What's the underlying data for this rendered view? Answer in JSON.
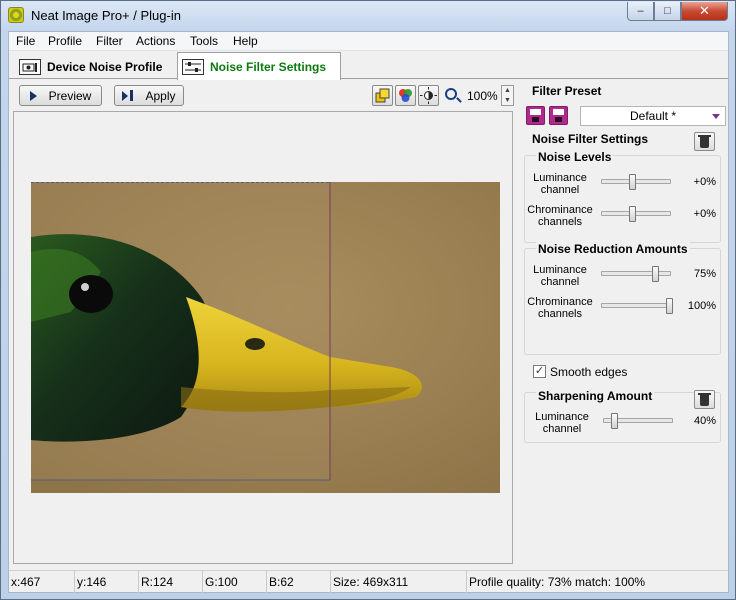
{
  "window": {
    "title": "Neat Image Pro+ / Plug-in"
  },
  "menu": [
    "File",
    "Profile",
    "Filter",
    "Actions",
    "Tools",
    "Help"
  ],
  "tabs": [
    {
      "label": "Device Noise Profile",
      "active": false
    },
    {
      "label": "Noise Filter Settings",
      "active": true
    }
  ],
  "toolbar": {
    "preview_label": "Preview",
    "apply_label": "Apply",
    "zoom": "100%"
  },
  "filter_preset": {
    "title": "Filter Preset",
    "value": "Default *"
  },
  "noise_filter_settings": {
    "title": "Noise Filter Settings",
    "noise_levels": {
      "title": "Noise Levels",
      "luminance": {
        "label": "Luminance channel",
        "value": "+0%",
        "level": 0.46
      },
      "chrominance": {
        "label": "Chrominance channels",
        "value": "+0%",
        "level": 0.46
      }
    },
    "noise_reduction": {
      "title": "Noise Reduction Amounts",
      "luminance": {
        "label": "Luminance channel",
        "value": "75%",
        "level": 0.75
      },
      "chrominance": {
        "label": "Chrominance channels",
        "value": "100%",
        "level": 1.0
      }
    },
    "smooth_edges": {
      "label": "Smooth edges",
      "checked": true
    }
  },
  "sharpening": {
    "title": "Sharpening Amount",
    "luminance": {
      "label": "Luminance channel",
      "value": "40%",
      "level": 0.12
    }
  },
  "status": {
    "x": "x:467",
    "y": "y:146",
    "r": "R:124",
    "g": "G:100",
    "b": "B:62",
    "size": "Size: 469x311",
    "quality": "Profile quality: 73%  match: 100%"
  },
  "colors": {
    "active_tab_text": "#0a7a10",
    "preset_accent": "#b02a8c"
  }
}
